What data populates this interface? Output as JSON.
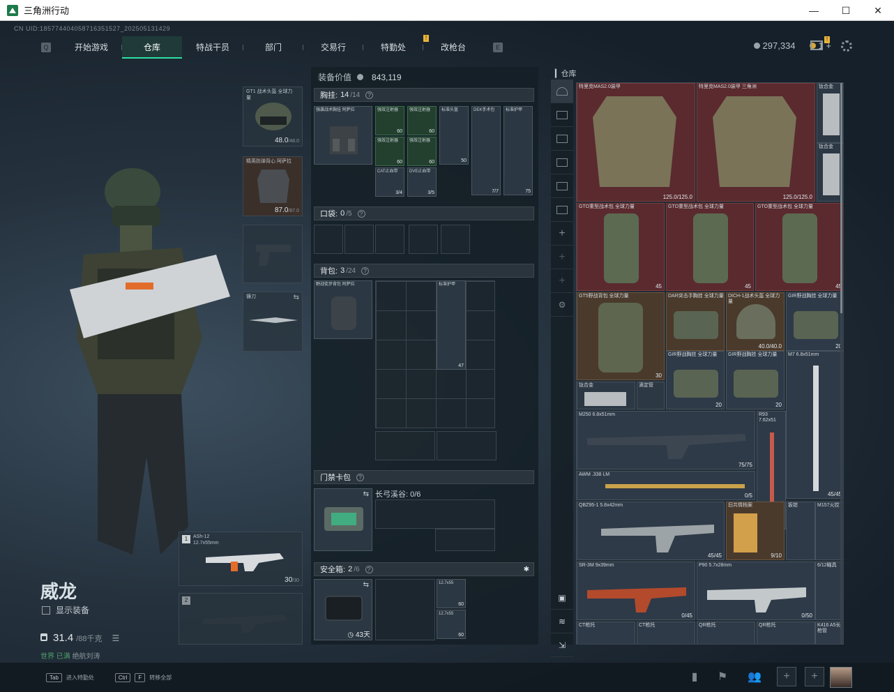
{
  "window": {
    "title": "三角洲行动"
  },
  "uid": "CN UID:18577440405871635152​7_202505131429",
  "nav": {
    "tabs": [
      "开始游戏",
      "仓库",
      "特战干员",
      "部门",
      "交易行",
      "特勤处",
      "改枪台"
    ],
    "active": "仓库"
  },
  "currency": {
    "silver": "297,334",
    "gold": "1",
    "plus": "+"
  },
  "operator": {
    "name": "威龙",
    "show_equip_label": "显示装备",
    "weight": "31.4",
    "weight_max": "/88千克",
    "status_world": "世界",
    "status_text": "已满",
    "status_extra": "绝航刘涛"
  },
  "loadout": {
    "helmet": {
      "name": "GT1 战术头盔 全球力量",
      "value": "48.0",
      "max": "/48.0"
    },
    "armor": {
      "name": "精英防弹背心 阿萨拉",
      "value": "87.0",
      "max": "/87.0"
    },
    "melee": {
      "name": "镰刀"
    },
    "primary": {
      "slot": "1",
      "name": "ASh-12",
      "caliber": "12.7x55mm",
      "ammo": "30",
      "ammo_max": "/30"
    },
    "secondary": {
      "slot": "2"
    }
  },
  "equipment": {
    "value_label": "装备价值",
    "value": "843,119",
    "chest": {
      "label": "胸挂:",
      "used": "14",
      "cap": "/14"
    },
    "pocket": {
      "label": "口袋:",
      "used": "0",
      "cap": "/5"
    },
    "backpack": {
      "label": "背包:",
      "used": "3",
      "cap": "/24"
    },
    "keycard": {
      "label": "门禁卡包"
    },
    "keycard_map": "长弓溪谷: 0/6",
    "safebox": {
      "label": "安全箱:",
      "used": "2",
      "cap": "/6",
      "days": "43天"
    },
    "chest_items": [
      {
        "name": "强袭战术胸挂 阿萨拉",
        "cnt": ""
      },
      {
        "name": "强效注射器",
        "cnt": "60"
      },
      {
        "name": "强效注射器",
        "cnt": "60"
      },
      {
        "name": "强效注射器",
        "cnt": "60"
      },
      {
        "name": "强效注射器",
        "cnt": "60"
      },
      {
        "name": "CAT止血带",
        "cnt": "3/4"
      },
      {
        "name": "DVE止血带",
        "cnt": "3/5"
      },
      {
        "name": "标准头盔",
        "cnt": "50"
      },
      {
        "name": "DEK手术包",
        "cnt": "7/7"
      },
      {
        "name": "标准护甲",
        "cnt": "75"
      }
    ],
    "backpack_items": [
      {
        "name": "野战徒步背包 阿萨拉"
      },
      {
        "name": "标准护甲",
        "cnt": "47"
      }
    ],
    "safebox_items": [
      {
        "name": "12.7x55",
        "cnt": "60"
      },
      {
        "name": "12.7x55",
        "cnt": "60"
      }
    ]
  },
  "stash": {
    "title": "仓库",
    "items": [
      {
        "name": "特里克MAS2.0装甲",
        "cnt": "125.0/125.0"
      },
      {
        "name": "特里克MAS2.0装甲 三角洲",
        "cnt": "125.0/125.0"
      },
      {
        "name": "钛合金",
        "cnt": ""
      },
      {
        "name": "钛合金",
        "cnt": ""
      },
      {
        "name": "GTO重型战术包 全球力量",
        "cnt": "45"
      },
      {
        "name": "GTO重型战术包 全球力量",
        "cnt": "45"
      },
      {
        "name": "GTO重型战术包 全球力量",
        "cnt": "45"
      },
      {
        "name": "GT5野战背包 全球力量",
        "cnt": "30"
      },
      {
        "name": "DAR突击手胸挂 全球力量",
        "cnt": ""
      },
      {
        "name": "DICH-1战术头盔 全球力量",
        "cnt": "40.0/40.0"
      },
      {
        "name": "GIR野战胸挂 全球力量",
        "cnt": "20"
      },
      {
        "name": "GIR野战胸挂 全球力量",
        "cnt": "20"
      },
      {
        "name": "GIR野战胸挂 全球力量",
        "cnt": "20"
      },
      {
        "name": "M7 6.8x51mm",
        "cnt": "45/45"
      },
      {
        "name": "钛合金",
        "cnt": ""
      },
      {
        "name": "滴定管",
        "cnt": ""
      },
      {
        "name": "M250 6.8x51mm",
        "cnt": "75/75"
      },
      {
        "name": "R93 7.62x51",
        "cnt": ""
      },
      {
        "name": "AWM .338 LM",
        "cnt": "0/5"
      },
      {
        "name": "QBZ95-1 5.8x42mm",
        "cnt": "45/45"
      },
      {
        "name": "旧共情档案",
        "cnt": "9/10"
      },
      {
        "name": "扳钳",
        "cnt": ""
      },
      {
        "name": "M157火控",
        "cnt": ""
      },
      {
        "name": "SR-3M 9x39mm",
        "cnt": "0/45"
      },
      {
        "name": "P90 5.7x28mm",
        "cnt": "0/50"
      },
      {
        "name": "6/12瞄具",
        "cnt": ""
      },
      {
        "name": "CT枪托",
        "cnt": ""
      },
      {
        "name": "CT枪托",
        "cnt": ""
      },
      {
        "name": "QR枪托",
        "cnt": ""
      },
      {
        "name": "QR枪托",
        "cnt": ""
      },
      {
        "name": "K416 A5长枪管",
        "cnt": ""
      }
    ]
  },
  "bottom": {
    "hint1_key": "Tab",
    "hint1": "进入特勤处",
    "hint2_key": "Ctrl",
    "hint2_key2": "F",
    "hint2": "转移全部"
  },
  "colors": {
    "accent": "#2de0a0",
    "badge": "#e8b33b",
    "red_item": "#5a2a2e"
  }
}
